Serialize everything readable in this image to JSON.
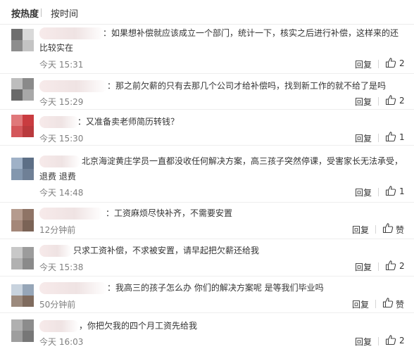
{
  "sort": {
    "hot": "按热度",
    "time": "按时间"
  },
  "reply_label": "回复",
  "colors": {
    "text": "#333333",
    "meta": "#808080",
    "divider": "#eeeeee"
  },
  "comments": [
    {
      "text": "：如果想补偿就应该成立一个部门，统计一下，核实之后进行补偿，这样来的还",
      "text2": "比较实在",
      "time": "今天 15:31",
      "likes": "2",
      "avatar": [
        "#6f6f6f",
        "#d9d9d9",
        "#8d8d8d",
        "#c4c4c4"
      ]
    },
    {
      "text": "：那之前欠薪的只有去那几个公司才给补偿吗，找到新工作的就不给了是吗",
      "text2": "",
      "time": "今天 15:29",
      "likes": "2",
      "avatar": [
        "#bdbdbd",
        "#8a8a8a",
        "#6a6a6a",
        "#a8a8a8"
      ]
    },
    {
      "text": "：又准备卖老师简历转钱？",
      "text2": "",
      "time": "今天 15:30",
      "likes": "1",
      "avatar": [
        "#e0787a",
        "#c93c40",
        "#d4575b",
        "#b93a3d"
      ]
    },
    {
      "text": "北京海淀黄庄学员一直都没收任何解决方案，高三孩子突然停课，受害家长无法承受，",
      "text2": "退费 退费",
      "time": "今天 14:48",
      "likes": "1",
      "avatar": [
        "#9fb1c7",
        "#5d6f86",
        "#8397ae",
        "#6f8096"
      ]
    },
    {
      "text": "：工资麻烦尽快补齐，不需要安置",
      "text2": "",
      "time": "12分钟前",
      "likes": "赞",
      "avatar": [
        "#b59b8e",
        "#8f7466",
        "#a48779",
        "#7b6356"
      ]
    },
    {
      "text": "只求工资补偿，不求被安置，请早起把欠薪还给我",
      "text2": "",
      "time": "今天 15:38",
      "likes": "2",
      "avatar": [
        "#c8c8c8",
        "#9c9c9c",
        "#b1b1b1",
        "#8a8a8a"
      ]
    },
    {
      "text": "：我高三的孩子怎么办 你们的解决方案呢  是等我们毕业吗",
      "text2": "",
      "time": "50分钟前",
      "likes": "赞",
      "avatar": [
        "#c8d3de",
        "#96a6b8",
        "#9c8a7d",
        "#7f6b5e"
      ]
    },
    {
      "text": "，你把欠我的四个月工资先给我",
      "text2": "",
      "time": "今天 16:03",
      "likes": "2",
      "avatar": [
        "#b0b0b0",
        "#8c8c8c",
        "#9e9e9e",
        "#777777"
      ]
    }
  ]
}
